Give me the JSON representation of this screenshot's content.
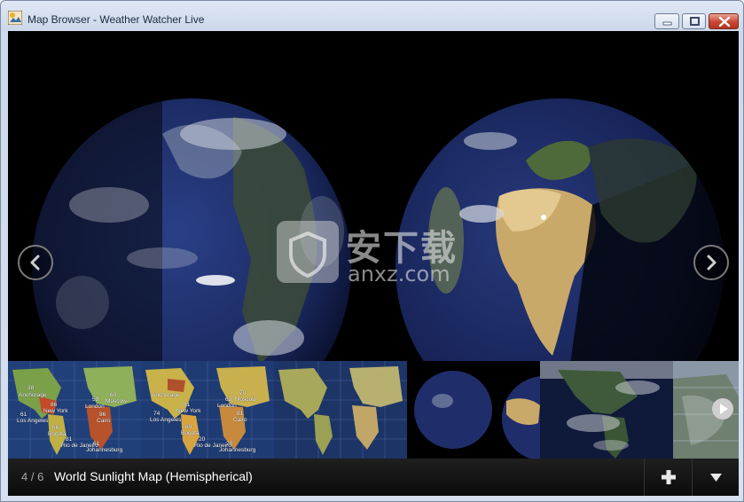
{
  "window": {
    "title": "Map Browser - Weather Watcher Live",
    "icon": "app-logo-icon"
  },
  "caption_buttons": {
    "minimize_icon": "minimize-icon",
    "maximize_icon": "maximize-icon",
    "close_icon": "close-icon"
  },
  "viewer": {
    "current_map": "World Sunlight Map (Hemispherical)",
    "prev_icon": "chevron-left-icon",
    "next_icon": "chevron-right-icon"
  },
  "watermark": {
    "title": "安下载",
    "subtitle": "anxz.com"
  },
  "thumbnails": [
    {
      "label": "World temperature map 1",
      "cities": [
        {
          "name": "Anchorage",
          "temp": "38"
        },
        {
          "name": "Moscow",
          "temp": "60"
        },
        {
          "name": "London",
          "temp": "59"
        },
        {
          "name": "New York",
          "temp": "86"
        },
        {
          "name": "Cairo",
          "temp": "86"
        },
        {
          "name": "Los Angeles",
          "temp": "61"
        },
        {
          "name": "Bogota",
          "temp": "66"
        },
        {
          "name": "Rio de Janeiro",
          "temp": "81"
        },
        {
          "name": "Johannesburg",
          "temp": "61"
        }
      ]
    },
    {
      "label": "World temperature map 2",
      "cities": [
        {
          "name": "Anchorage",
          "temp": ""
        },
        {
          "name": "Moscow",
          "temp": "70"
        },
        {
          "name": "London",
          "temp": "63"
        },
        {
          "name": "New York",
          "temp": "81"
        },
        {
          "name": "Cairo",
          "temp": "81"
        },
        {
          "name": "Los Angeles",
          "temp": "74"
        },
        {
          "name": "Bogota",
          "temp": "69"
        },
        {
          "name": "Rio de Janeiro",
          "temp": "20"
        },
        {
          "name": "Johannesburg",
          "temp": "20"
        }
      ]
    },
    {
      "label": "World terrain map"
    },
    {
      "label": "World Sunlight Map (Hemispherical)"
    },
    {
      "label": "Americas satellite map"
    },
    {
      "label": "Radar map",
      "play_icon": "play-icon"
    }
  ],
  "bottom_bar": {
    "position": "4",
    "total": "6",
    "counter_text": "4 / 6",
    "add_icon": "plus-icon",
    "menu_icon": "triangle-down-icon"
  },
  "colors": {
    "titlebar": "#d6e0ee",
    "close_button": "#c94732",
    "viewer_background": "#000000",
    "bottom_bar": "#151515",
    "title_text": "#ffffff",
    "counter_text": "#a9a9a9"
  }
}
